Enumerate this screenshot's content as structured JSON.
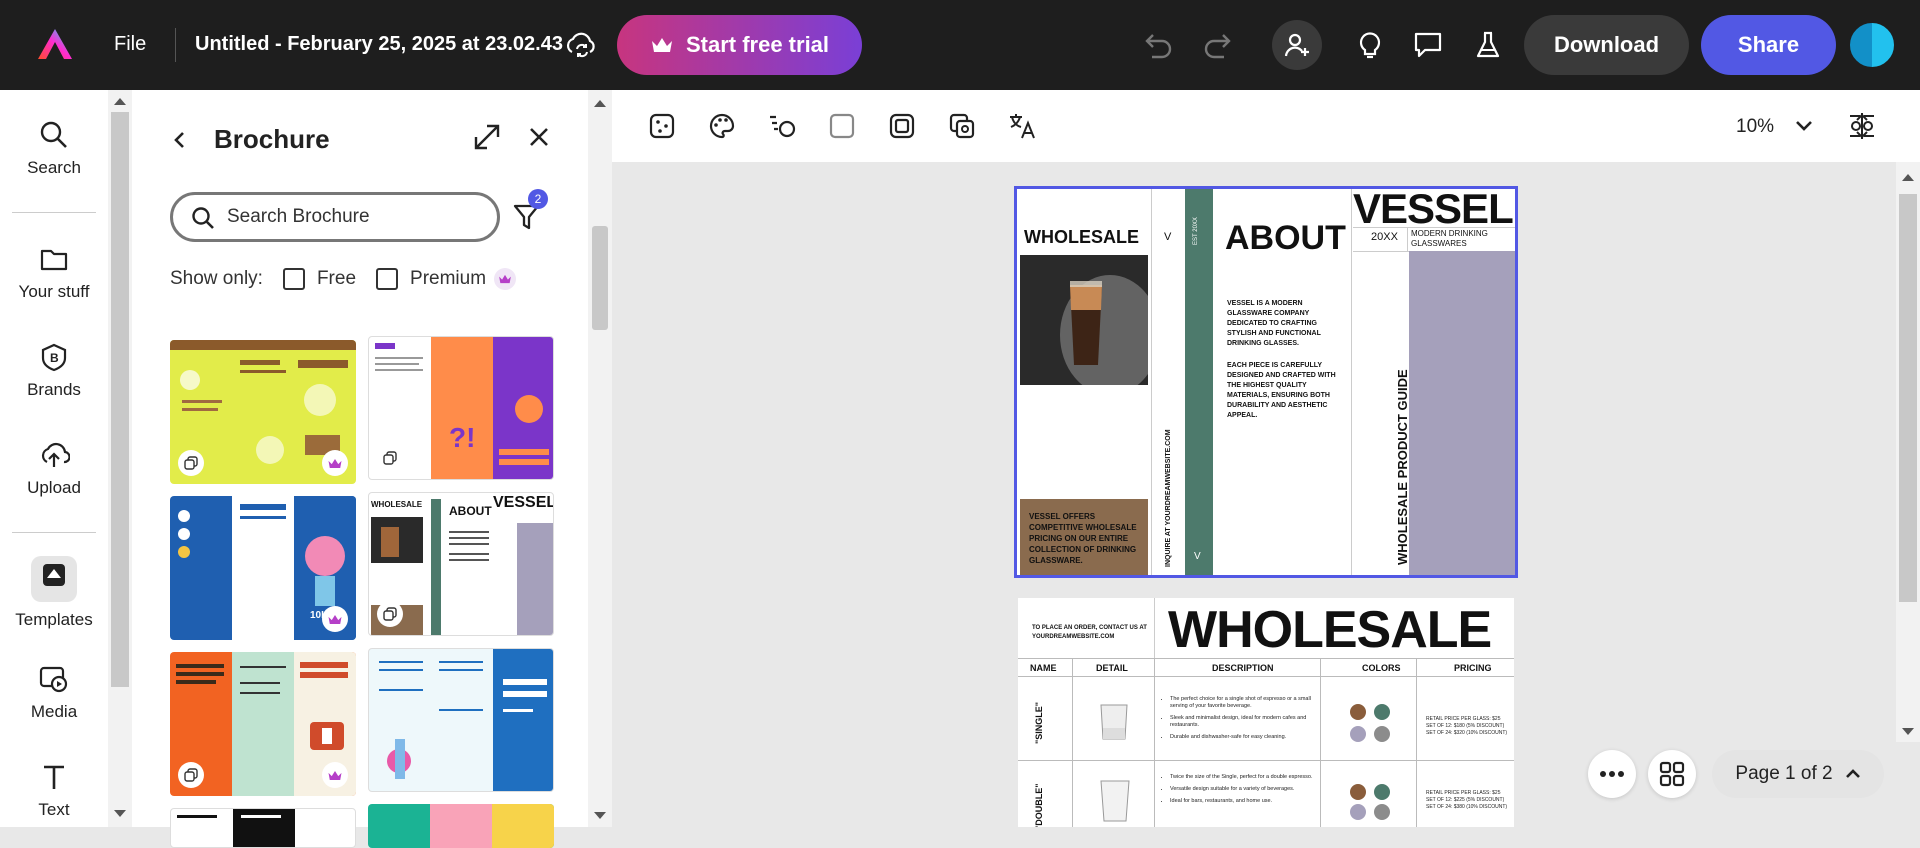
{
  "topbar": {
    "file_label": "File",
    "doc_title": "Untitled - February 25, 2025 at 23.02.43",
    "trial_label": "Start free trial",
    "download_label": "Download",
    "share_label": "Share"
  },
  "rail": {
    "items": [
      {
        "label": "Search",
        "icon": "search-icon"
      },
      {
        "label": "Your stuff",
        "icon": "folder-icon"
      },
      {
        "label": "Brands",
        "icon": "brand-icon"
      },
      {
        "label": "Upload",
        "icon": "upload-cloud-icon"
      },
      {
        "label": "Templates",
        "icon": "templates-icon"
      },
      {
        "label": "Media",
        "icon": "media-icon"
      },
      {
        "label": "Text",
        "icon": "text-icon"
      }
    ]
  },
  "panel": {
    "title": "Brochure",
    "search_placeholder": "Search Brochure",
    "filter_count": "2",
    "show_only": "Show only:",
    "free_label": "Free",
    "premium_label": "Premium"
  },
  "canvas": {
    "zoom": "10%",
    "page_indicator": "Page 1 of 2"
  },
  "brochure": {
    "wholesale": "WHOLESALE",
    "v": "V",
    "est": "EST 20XX",
    "about": "ABOUT",
    "vessel": "VESSEL",
    "year": "20XX",
    "tagline": "MODERN DRINKING GLASSWARES",
    "about_p1": "VESSEL IS A MODERN GLASSWARE COMPANY DEDICATED TO CRAFTING STYLISH AND FUNCTIONAL DRINKING GLASSES.",
    "about_p2": "EACH PIECE IS CAREFULLY DESIGNED AND CRAFTED WITH THE HIGHEST QUALITY MATERIALS, ENSURING BOTH DURABILITY AND AESTHETIC APPEAL.",
    "offer": "VESSEL OFFERS COMPETITIVE WHOLESALE PRICING ON OUR ENTIRE COLLECTION OF DRINKING GLASSWARE.",
    "inquire": "INQUIRE AT YOURDREAMWEBSITE.COM",
    "guide": "WHOLESALE PRODUCT GUIDE",
    "order_note": "TO PLACE AN ORDER, CONTACT US AT YOURDREAMWEBSITE.COM",
    "headers": [
      "NAME",
      "DETAIL",
      "DESCRIPTION",
      "COLORS",
      "PRICING"
    ],
    "rows": [
      {
        "name": "\"SINGLE\"",
        "desc": [
          "The perfect choice for a single shot of espresso or a small serving of your favorite beverage.",
          "Sleek and minimalist design, ideal for modern cafes and restaurants.",
          "Durable and dishwasher-safe for easy cleaning."
        ],
        "price": [
          "RETAIL PRICE PER GLASS: $25",
          "SET OF 12: $180 (5% DISCOUNT)",
          "SET OF 24: $320 (10% DISCOUNT)"
        ]
      },
      {
        "name": "\"DOUBLE\"",
        "desc": [
          "Twice the size of the Single, perfect for a double espresso.",
          "Versatile design suitable for a variety of beverages.",
          "Ideal for bars, restaurants, and home use."
        ],
        "price": [
          "RETAIL PRICE PER GLASS: $25",
          "SET OF 12: $225 (5% DISCOUNT)",
          "SET OF 24: $380 (10% DISCOUNT)"
        ]
      }
    ],
    "swatches": [
      "#8a5d3b",
      "#4d7a6c",
      "#a5a0bb",
      "#8c8c8c"
    ]
  },
  "colors": {
    "accent": "#5258e4",
    "topbar": "#1e1e1e",
    "brochure_green": "#4d7a6c",
    "brochure_lavender": "#a5a0bb",
    "brochure_brown": "#8a6b4e"
  }
}
